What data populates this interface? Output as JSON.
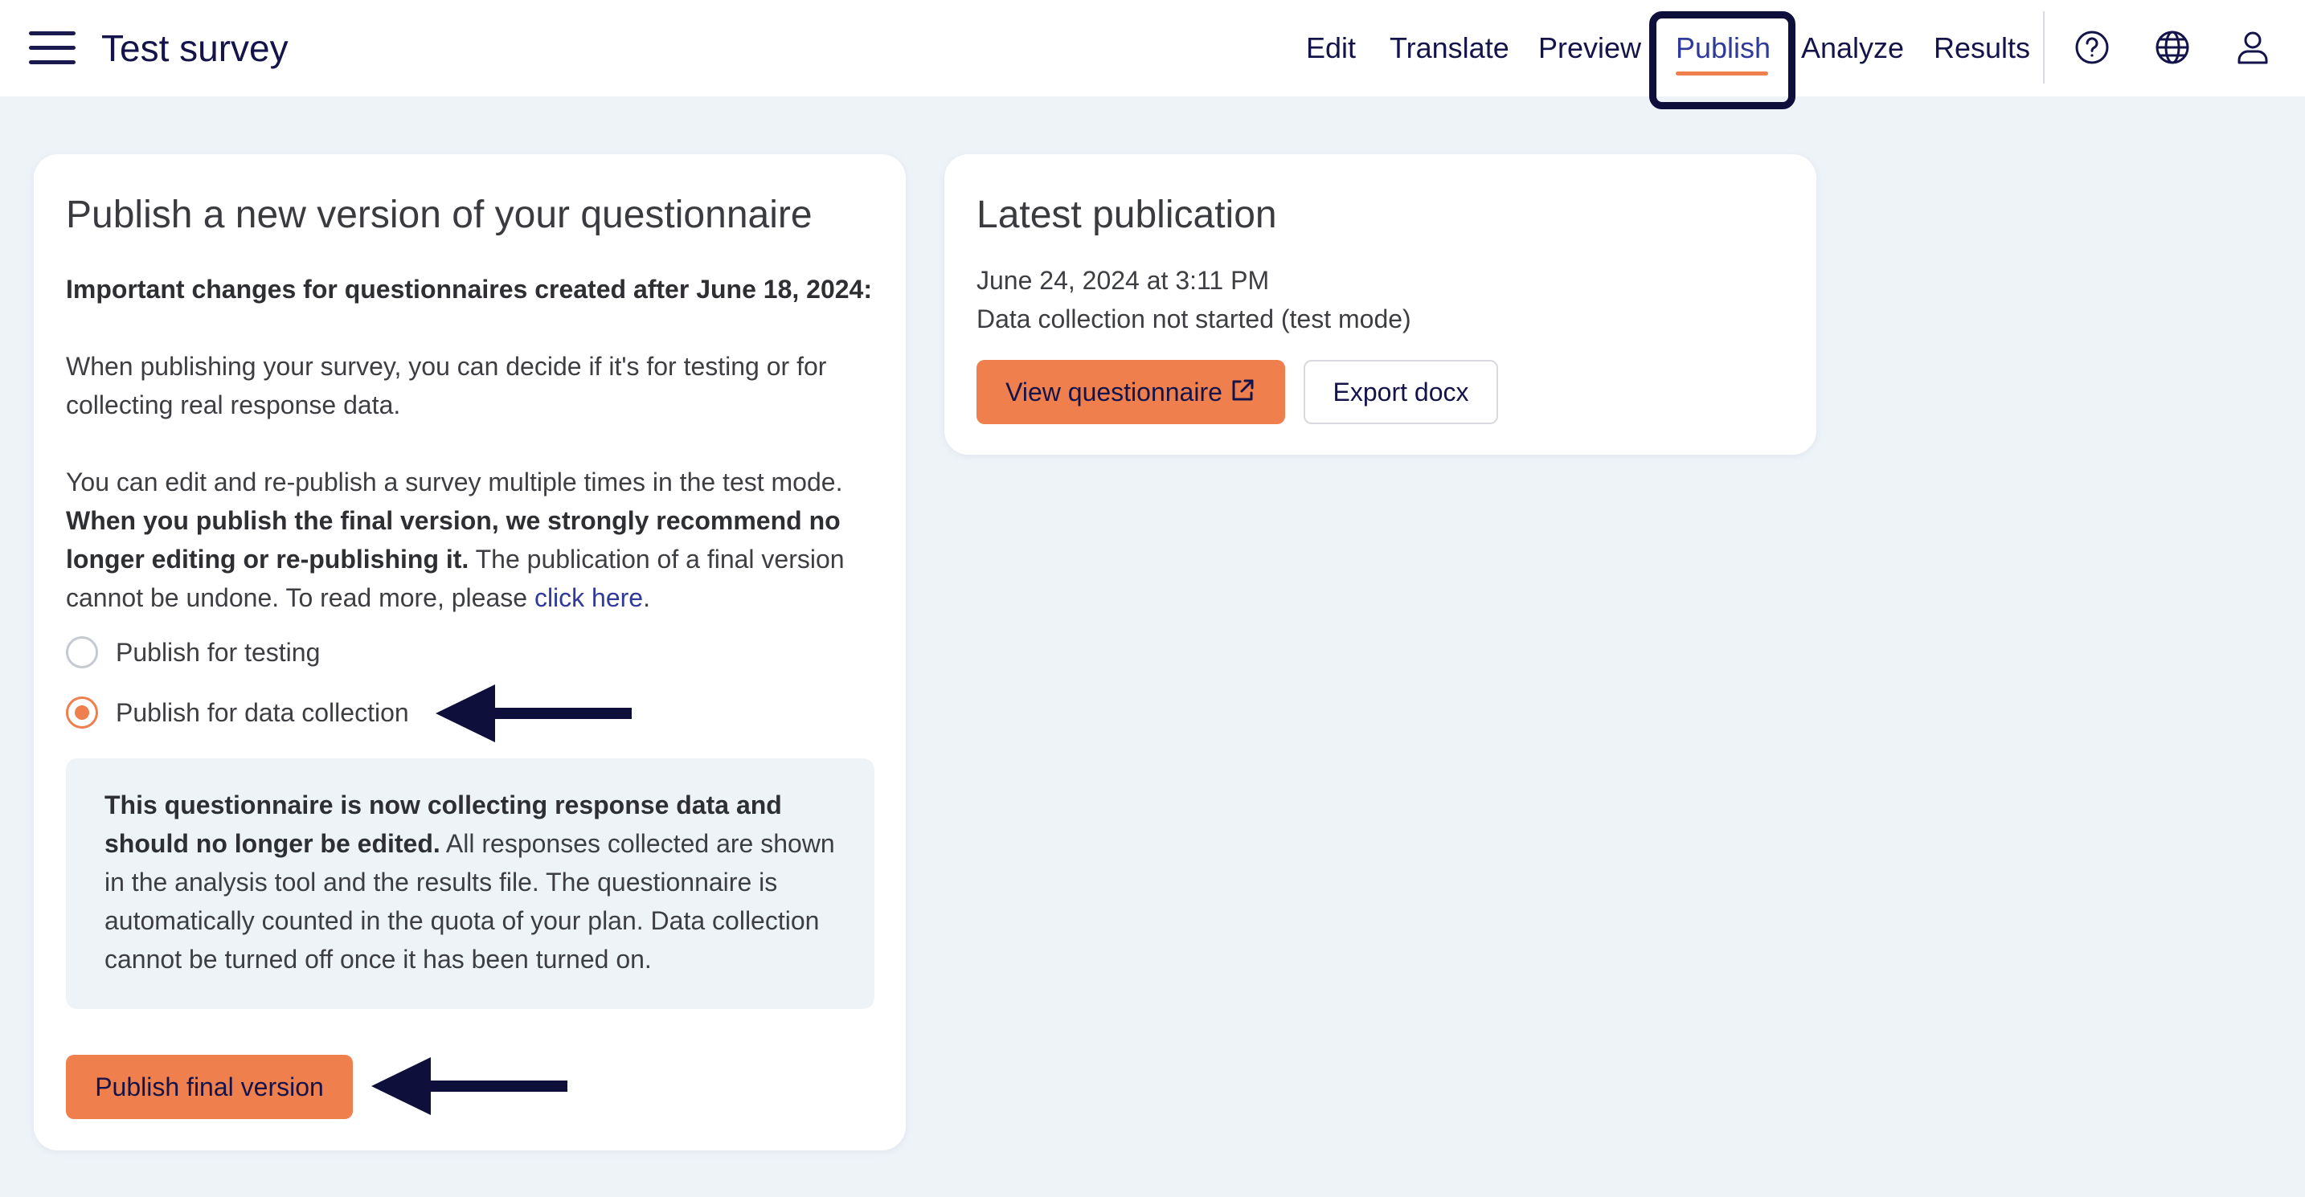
{
  "header": {
    "title": "Test survey",
    "nav": {
      "edit": "Edit",
      "translate": "Translate",
      "preview": "Preview",
      "publish": "Publish",
      "analyze": "Analyze",
      "results": "Results"
    },
    "active_tab": "Publish",
    "icons": [
      "menu-icon",
      "help-icon",
      "globe-icon",
      "user-icon"
    ]
  },
  "publish_card": {
    "title": "Publish a new version of your questionnaire",
    "important": "Important changes for questionnaires created after June 18, 2024:",
    "decide": "When publishing your survey, you can decide if it's for testing or for collecting real response data.",
    "edit_intro": "You can edit and re-publish a survey multiple times in the test mode.",
    "edit_bold": "When you publish the final version, we strongly recommend no longer editing or re-publishing it.",
    "edit_rest": "The publication of a final version cannot be undone. To read more, please",
    "link_text": "click here",
    "period": ".",
    "options": {
      "testing": "Publish for testing",
      "collection": "Publish for data collection"
    },
    "selected_option": "Publish for data collection",
    "info_bold": "This questionnaire is now collecting response data and should no longer be edited.",
    "info_rest": "All responses collected are shown in the analysis tool and the results file. The questionnaire is automatically counted in the quota of your plan. Data collection cannot be turned off once it has been turned on.",
    "publish_button": "Publish final version"
  },
  "latest_card": {
    "title": "Latest publication",
    "date": "June 24, 2024 at 3:11 PM",
    "status": "Data collection not started (test mode)",
    "view_button": "View questionnaire",
    "export_button": "Export docx"
  },
  "colors": {
    "accent": "#ef7f4d",
    "navy": "#14144a",
    "link": "#2f3a9a",
    "background": "#eef3f8"
  }
}
